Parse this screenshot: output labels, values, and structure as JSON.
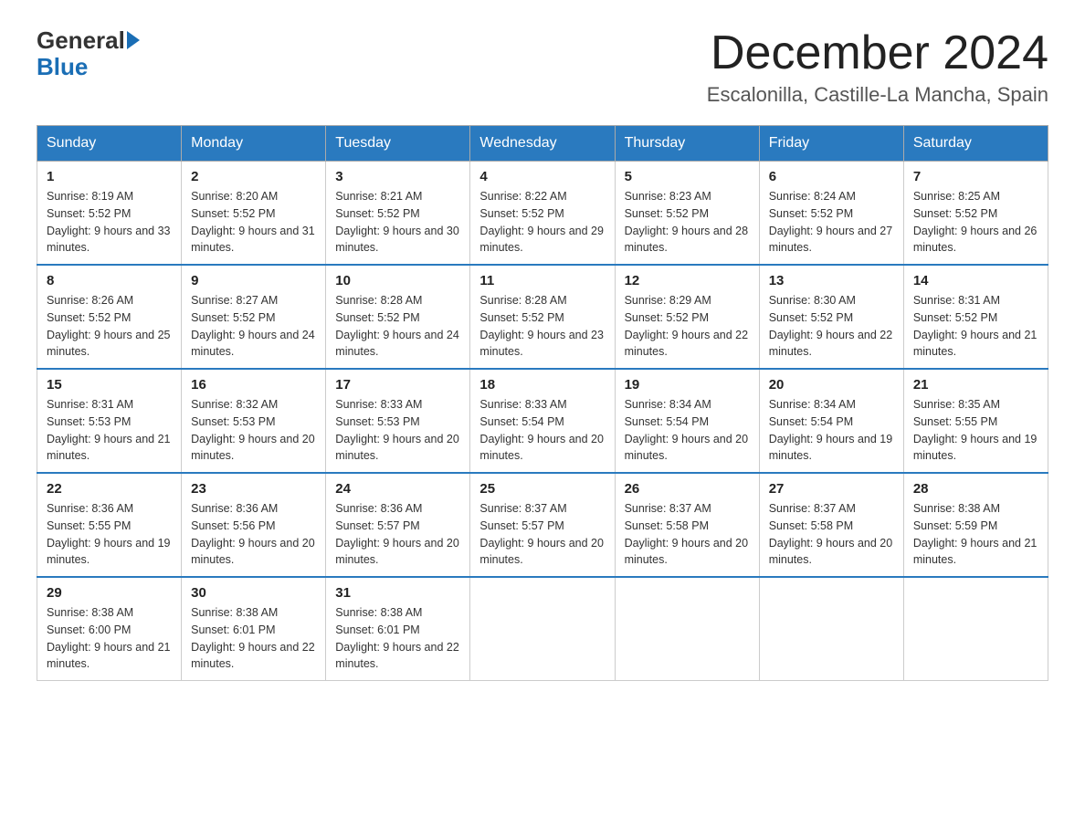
{
  "logo": {
    "text_general": "General",
    "text_blue": "Blue"
  },
  "header": {
    "title": "December 2024",
    "subtitle": "Escalonilla, Castille-La Mancha, Spain"
  },
  "days_of_week": [
    "Sunday",
    "Monday",
    "Tuesday",
    "Wednesday",
    "Thursday",
    "Friday",
    "Saturday"
  ],
  "weeks": [
    [
      {
        "num": "1",
        "sunrise": "8:19 AM",
        "sunset": "5:52 PM",
        "daylight": "9 hours and 33 minutes."
      },
      {
        "num": "2",
        "sunrise": "8:20 AM",
        "sunset": "5:52 PM",
        "daylight": "9 hours and 31 minutes."
      },
      {
        "num": "3",
        "sunrise": "8:21 AM",
        "sunset": "5:52 PM",
        "daylight": "9 hours and 30 minutes."
      },
      {
        "num": "4",
        "sunrise": "8:22 AM",
        "sunset": "5:52 PM",
        "daylight": "9 hours and 29 minutes."
      },
      {
        "num": "5",
        "sunrise": "8:23 AM",
        "sunset": "5:52 PM",
        "daylight": "9 hours and 28 minutes."
      },
      {
        "num": "6",
        "sunrise": "8:24 AM",
        "sunset": "5:52 PM",
        "daylight": "9 hours and 27 minutes."
      },
      {
        "num": "7",
        "sunrise": "8:25 AM",
        "sunset": "5:52 PM",
        "daylight": "9 hours and 26 minutes."
      }
    ],
    [
      {
        "num": "8",
        "sunrise": "8:26 AM",
        "sunset": "5:52 PM",
        "daylight": "9 hours and 25 minutes."
      },
      {
        "num": "9",
        "sunrise": "8:27 AM",
        "sunset": "5:52 PM",
        "daylight": "9 hours and 24 minutes."
      },
      {
        "num": "10",
        "sunrise": "8:28 AM",
        "sunset": "5:52 PM",
        "daylight": "9 hours and 24 minutes."
      },
      {
        "num": "11",
        "sunrise": "8:28 AM",
        "sunset": "5:52 PM",
        "daylight": "9 hours and 23 minutes."
      },
      {
        "num": "12",
        "sunrise": "8:29 AM",
        "sunset": "5:52 PM",
        "daylight": "9 hours and 22 minutes."
      },
      {
        "num": "13",
        "sunrise": "8:30 AM",
        "sunset": "5:52 PM",
        "daylight": "9 hours and 22 minutes."
      },
      {
        "num": "14",
        "sunrise": "8:31 AM",
        "sunset": "5:52 PM",
        "daylight": "9 hours and 21 minutes."
      }
    ],
    [
      {
        "num": "15",
        "sunrise": "8:31 AM",
        "sunset": "5:53 PM",
        "daylight": "9 hours and 21 minutes."
      },
      {
        "num": "16",
        "sunrise": "8:32 AM",
        "sunset": "5:53 PM",
        "daylight": "9 hours and 20 minutes."
      },
      {
        "num": "17",
        "sunrise": "8:33 AM",
        "sunset": "5:53 PM",
        "daylight": "9 hours and 20 minutes."
      },
      {
        "num": "18",
        "sunrise": "8:33 AM",
        "sunset": "5:54 PM",
        "daylight": "9 hours and 20 minutes."
      },
      {
        "num": "19",
        "sunrise": "8:34 AM",
        "sunset": "5:54 PM",
        "daylight": "9 hours and 20 minutes."
      },
      {
        "num": "20",
        "sunrise": "8:34 AM",
        "sunset": "5:54 PM",
        "daylight": "9 hours and 19 minutes."
      },
      {
        "num": "21",
        "sunrise": "8:35 AM",
        "sunset": "5:55 PM",
        "daylight": "9 hours and 19 minutes."
      }
    ],
    [
      {
        "num": "22",
        "sunrise": "8:36 AM",
        "sunset": "5:55 PM",
        "daylight": "9 hours and 19 minutes."
      },
      {
        "num": "23",
        "sunrise": "8:36 AM",
        "sunset": "5:56 PM",
        "daylight": "9 hours and 20 minutes."
      },
      {
        "num": "24",
        "sunrise": "8:36 AM",
        "sunset": "5:57 PM",
        "daylight": "9 hours and 20 minutes."
      },
      {
        "num": "25",
        "sunrise": "8:37 AM",
        "sunset": "5:57 PM",
        "daylight": "9 hours and 20 minutes."
      },
      {
        "num": "26",
        "sunrise": "8:37 AM",
        "sunset": "5:58 PM",
        "daylight": "9 hours and 20 minutes."
      },
      {
        "num": "27",
        "sunrise": "8:37 AM",
        "sunset": "5:58 PM",
        "daylight": "9 hours and 20 minutes."
      },
      {
        "num": "28",
        "sunrise": "8:38 AM",
        "sunset": "5:59 PM",
        "daylight": "9 hours and 21 minutes."
      }
    ],
    [
      {
        "num": "29",
        "sunrise": "8:38 AM",
        "sunset": "6:00 PM",
        "daylight": "9 hours and 21 minutes."
      },
      {
        "num": "30",
        "sunrise": "8:38 AM",
        "sunset": "6:01 PM",
        "daylight": "9 hours and 22 minutes."
      },
      {
        "num": "31",
        "sunrise": "8:38 AM",
        "sunset": "6:01 PM",
        "daylight": "9 hours and 22 minutes."
      },
      null,
      null,
      null,
      null
    ]
  ]
}
